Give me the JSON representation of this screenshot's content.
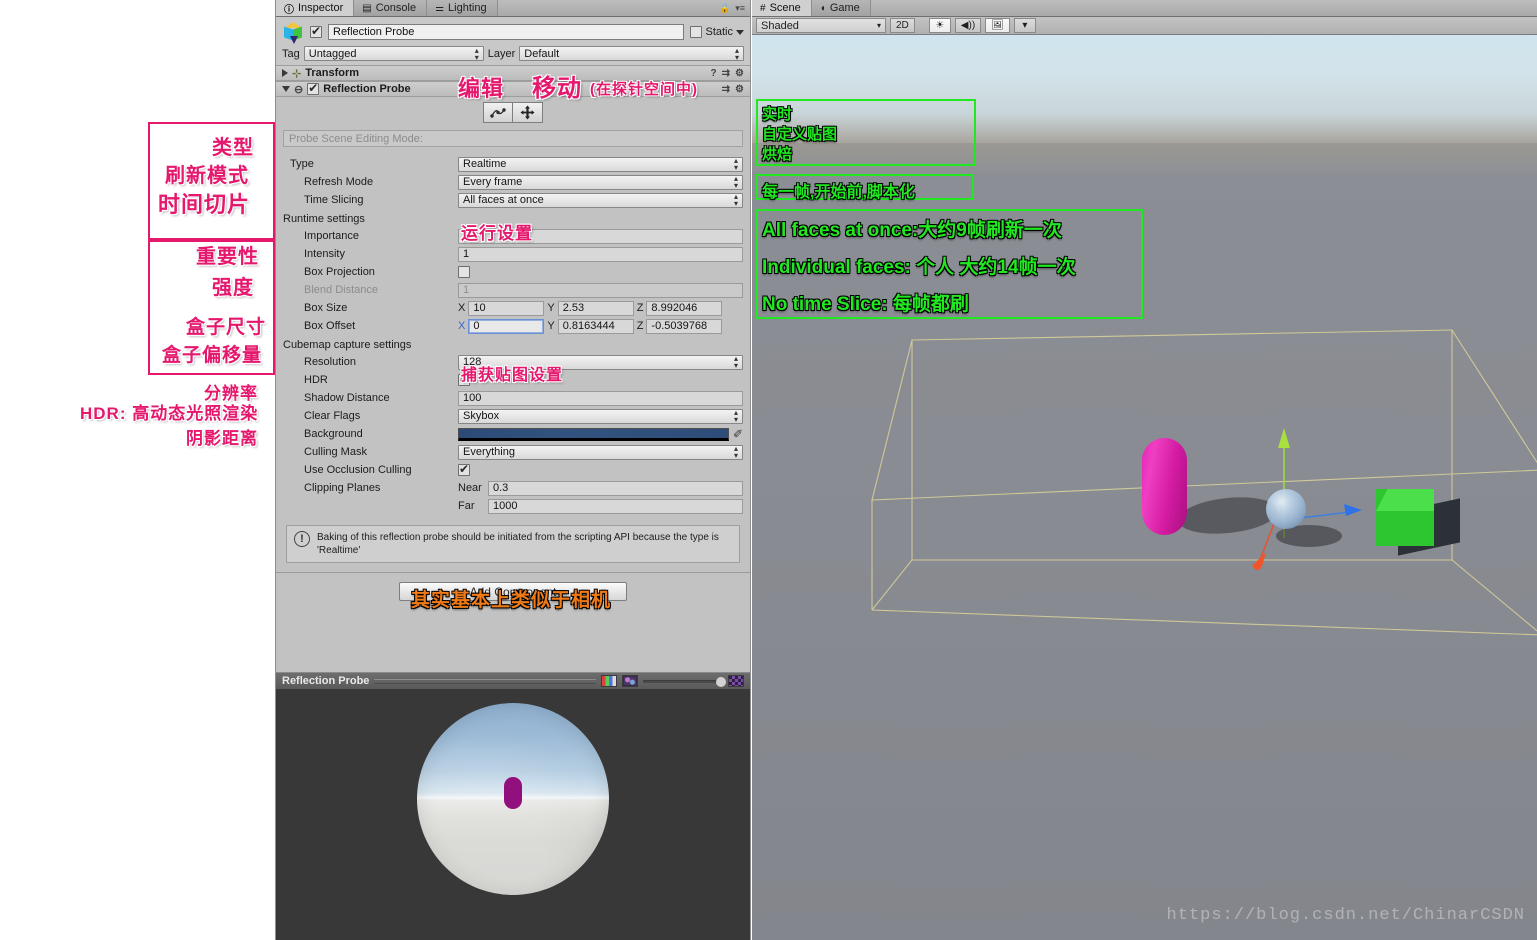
{
  "inspector": {
    "tabs": [
      {
        "label": "Inspector",
        "icon": "info-icon",
        "active": true
      },
      {
        "label": "Console",
        "icon": "console-icon",
        "active": false
      },
      {
        "label": "Lighting",
        "icon": "sliders-icon",
        "active": false
      }
    ],
    "object": {
      "name": "Reflection Probe",
      "enabled": true,
      "static_label": "Static",
      "static_checked": false,
      "tag_label": "Tag",
      "tag_value": "Untagged",
      "layer_label": "Layer",
      "layer_value": "Default"
    },
    "transform": {
      "title": "Transform"
    },
    "component": {
      "title": "Reflection Probe",
      "enabled": true,
      "edit_mode_placeholder": "Probe Scene Editing Mode:",
      "tool_edit": "edit-bounds-icon",
      "tool_move": "move-icon"
    },
    "fields": {
      "type_label": "Type",
      "type_value": "Realtime",
      "refresh_mode_label": "Refresh Mode",
      "refresh_mode_value": "Every frame",
      "time_slicing_label": "Time Slicing",
      "time_slicing_value": "All faces at once",
      "runtime_settings_label": "Runtime settings",
      "importance_label": "Importance",
      "importance_value": "1",
      "intensity_label": "Intensity",
      "intensity_value": "1",
      "box_projection_label": "Box Projection",
      "box_projection_checked": false,
      "blend_distance_label": "Blend Distance",
      "blend_distance_value": "1",
      "box_size_label": "Box Size",
      "box_size_x": "10",
      "box_size_y": "2.53",
      "box_size_z": "8.992046",
      "box_offset_label": "Box Offset",
      "box_offset_x": "0",
      "box_offset_y": "0.8163444",
      "box_offset_z": "-0.5039768",
      "axis_x": "X",
      "axis_y": "Y",
      "axis_z": "Z",
      "cubemap_label": "Cubemap capture settings",
      "resolution_label": "Resolution",
      "resolution_value": "128",
      "hdr_label": "HDR",
      "hdr_checked": true,
      "shadow_distance_label": "Shadow Distance",
      "shadow_distance_value": "100",
      "clear_flags_label": "Clear Flags",
      "clear_flags_value": "Skybox",
      "background_label": "Background",
      "background_color": "#2e4c79",
      "culling_mask_label": "Culling Mask",
      "culling_mask_value": "Everything",
      "use_occlusion_label": "Use Occlusion Culling",
      "use_occlusion_checked": true,
      "clipping_planes_label": "Clipping Planes",
      "near_label": "Near",
      "near_value": "0.3",
      "far_label": "Far",
      "far_value": "1000"
    },
    "helpbox": {
      "icon": "warning-icon",
      "text": "Baking of this reflection probe should be initiated from the scripting API because the type is 'Realtime'"
    },
    "add_component_label": "Add Component",
    "preview": {
      "title": "Reflection Probe",
      "icons": [
        "rgb-channels-icon",
        "cubemap-icon",
        "mip-slider",
        "checker-icon"
      ]
    }
  },
  "scene": {
    "tabs": [
      {
        "label": "Scene",
        "icon": "grid-icon",
        "active": true
      },
      {
        "label": "Game",
        "icon": "gamepad-icon",
        "active": false
      }
    ],
    "toolbar": {
      "draw_mode": "Shaded",
      "two_d": "2D",
      "lighting_icon": "sun-icon",
      "audio_icon": "speaker-icon",
      "fx_icon": "image-icon",
      "fx_caret": "chevron-down-icon"
    },
    "objects": [
      "magenta-capsule",
      "green-cube",
      "reflection-probe-gizmo",
      "probe-bounds-box"
    ],
    "watermark": "https://blog.csdn.net/ChinarCSDN"
  },
  "annotations": {
    "pink": {
      "edit": "编辑",
      "move": "移动",
      "move_note": "(在探针空间中)",
      "runtime_settings": "运行设置",
      "cubemap_capture": "捕获贴图设置",
      "type": "类型",
      "refresh_mode": "刷新模式",
      "time_slicing": "时间切片",
      "importance": "重要性",
      "intensity": "强度",
      "box_size": "盒子尺寸",
      "box_offset": "盒子偏移量",
      "resolution": "分辨率",
      "hdr": "HDR:  高动态光照渲染",
      "shadow_distance": "阴影距离"
    },
    "orange": {
      "like_camera": "其实基本上类似于相机"
    },
    "green": {
      "type_opt1": "实时",
      "type_opt2": "自定义贴图",
      "type_opt3": "烘焙",
      "refresh_opts": "每一帧,开始前,脚本化",
      "slice1": "All faces at once:大约9帧刷新一次",
      "slice2": "Individual  faces: 个人 大约14帧一次",
      "slice3": "No time Slice: 每帧都刷"
    }
  }
}
